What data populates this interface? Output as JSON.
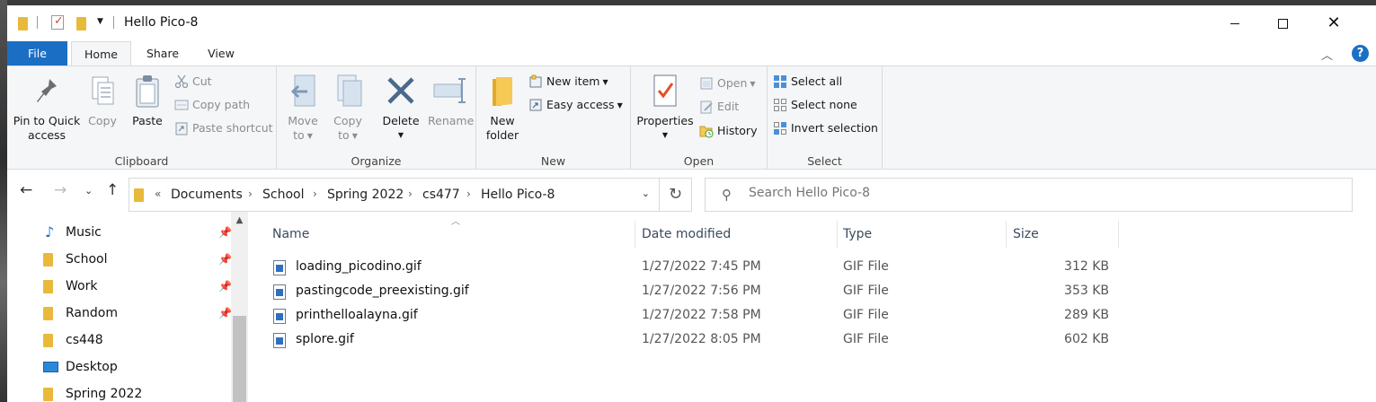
{
  "window": {
    "title": "Hello Pico-8",
    "controls": {
      "minimize_icon": "minimize-icon",
      "maximize_icon": "maximize-icon",
      "close_icon": "close-icon"
    }
  },
  "ribbon_tabs": [
    "File",
    "Home",
    "Share",
    "View"
  ],
  "help_label": "?",
  "ribbon": {
    "clipboard": {
      "label": "Clipboard",
      "pin_line1": "Pin to Quick",
      "pin_line2": "access",
      "copy": "Copy",
      "paste": "Paste",
      "cut": "Cut",
      "copy_path": "Copy path",
      "paste_shortcut": "Paste shortcut"
    },
    "organize": {
      "label": "Organize",
      "move_line1": "Move",
      "move_line2": "to",
      "copy_line1": "Copy",
      "copy_line2": "to",
      "delete": "Delete",
      "rename": "Rename"
    },
    "new": {
      "label": "New",
      "folder_line1": "New",
      "folder_line2": "folder",
      "new_item": "New item",
      "easy_access": "Easy access"
    },
    "open": {
      "label": "Open",
      "properties": "Properties",
      "open": "Open",
      "edit": "Edit",
      "history": "History"
    },
    "select": {
      "label": "Select",
      "select_all": "Select all",
      "select_none": "Select none",
      "invert": "Invert selection"
    }
  },
  "address": {
    "overflow": "«",
    "crumbs": [
      "Documents",
      "School",
      "Spring 2022",
      "cs477",
      "Hello Pico-8"
    ]
  },
  "search": {
    "placeholder": "Search Hello Pico-8"
  },
  "nav_items": [
    {
      "label": "Music",
      "icon": "music-icon",
      "pinned": true
    },
    {
      "label": "School",
      "icon": "folder-icon",
      "pinned": true
    },
    {
      "label": "Work",
      "icon": "folder-icon",
      "pinned": true
    },
    {
      "label": "Random",
      "icon": "folder-icon",
      "pinned": true
    },
    {
      "label": "cs448",
      "icon": "folder-icon",
      "pinned": false
    },
    {
      "label": "Desktop",
      "icon": "desktop-icon",
      "pinned": false
    },
    {
      "label": "Spring 2022",
      "icon": "folder-icon",
      "pinned": false
    }
  ],
  "columns": {
    "name": "Name",
    "date": "Date modified",
    "type": "Type",
    "size": "Size"
  },
  "files": [
    {
      "name": "loading_picodino.gif",
      "date": "1/27/2022 7:45 PM",
      "type": "GIF File",
      "size": "312 KB"
    },
    {
      "name": "pastingcode_preexisting.gif",
      "date": "1/27/2022 7:56 PM",
      "type": "GIF File",
      "size": "353 KB"
    },
    {
      "name": "printhelloalayna.gif",
      "date": "1/27/2022 7:58 PM",
      "type": "GIF File",
      "size": "289 KB"
    },
    {
      "name": "splore.gif",
      "date": "1/27/2022 8:05 PM",
      "type": "GIF File",
      "size": "602 KB"
    }
  ],
  "colors": {
    "accent": "#1a6fc4",
    "ribbon_bg": "#f5f6f7",
    "folder": "#e8b93a"
  }
}
